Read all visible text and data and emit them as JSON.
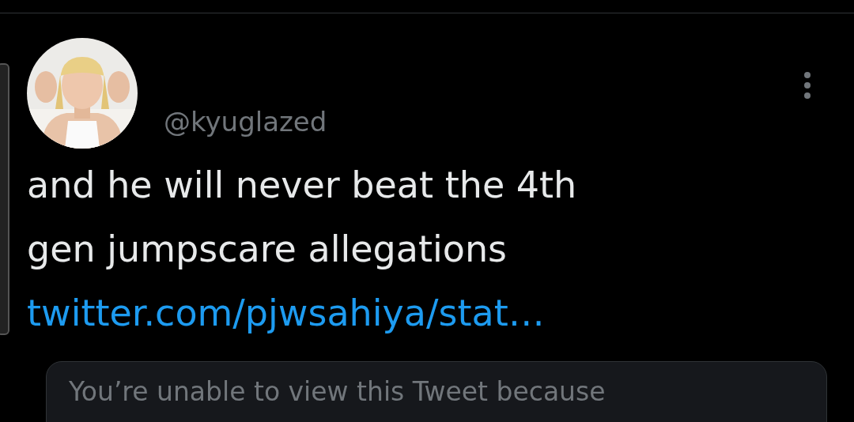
{
  "tweet": {
    "handle": "@kyuglazed",
    "text_lines": [
      "and he will never beat the 4th",
      "gen jumpscare allegations"
    ],
    "link": "twitter.com/pjwsahiya/stat…",
    "quoted_notice": "You’re unable to view this Tweet because"
  }
}
